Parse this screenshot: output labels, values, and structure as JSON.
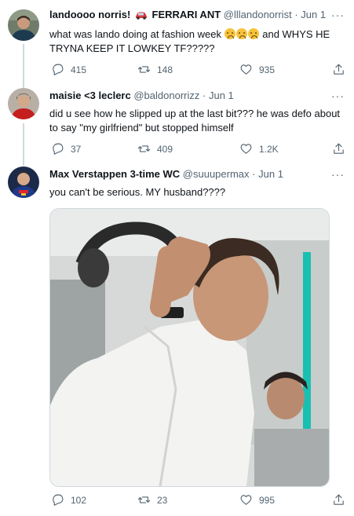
{
  "tweets": [
    {
      "name": "landoooo norris!",
      "name_suffix": "FERRARI ANT",
      "handle": "@lllandonorrist",
      "date": "Jun 1",
      "text_before": "what was lando doing at fashion week",
      "text_after": "and WHYS HE TRYNA KEEP IT LOWKEY TF?????",
      "replies": "415",
      "retweets": "148",
      "likes": "935"
    },
    {
      "name": "maisie <3 leclerc",
      "handle": "@baldonorrizz",
      "date": "Jun 1",
      "text": "did u see how he slipped up at the last bit??? he was defo about to say \"my girlfriend\" but stopped himself",
      "replies": "37",
      "retweets": "409",
      "likes": "1.2K"
    },
    {
      "name": "Max Verstappen 3-time WC",
      "handle": "@suuupermax",
      "date": "Jun 1",
      "text": "you can't be serious. MY husband????",
      "replies": "102",
      "retweets": "23",
      "likes": "995"
    }
  ],
  "separator": "·",
  "more_glyph": "···",
  "icons": {
    "reply": "reply-icon",
    "retweet": "retweet-icon",
    "like": "heart-icon",
    "share": "share-icon",
    "name_emoji": "car-icon",
    "text_emoji": "crying-face-emoji"
  },
  "colors": {
    "text": "#0f1419",
    "secondary": "#536471",
    "thread_line": "#cfd9de"
  }
}
